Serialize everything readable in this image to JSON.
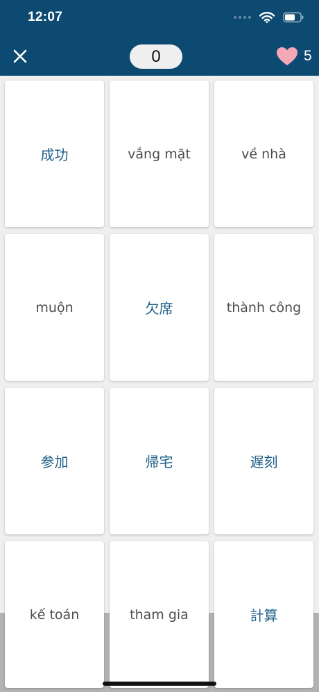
{
  "status_bar": {
    "time": "12:07"
  },
  "header": {
    "score": "0",
    "lives": "5",
    "colors": {
      "bar": "#0d4a72",
      "heart": "#f5a9b8"
    }
  },
  "cards": [
    {
      "text": "成功",
      "lang": "zh"
    },
    {
      "text": "vắng mặt",
      "lang": "vi"
    },
    {
      "text": "về nhà",
      "lang": "vi"
    },
    {
      "text": "muộn",
      "lang": "vi"
    },
    {
      "text": "欠席",
      "lang": "zh"
    },
    {
      "text": "thành công",
      "lang": "vi"
    },
    {
      "text": "参加",
      "lang": "zh"
    },
    {
      "text": "帰宅",
      "lang": "zh"
    },
    {
      "text": "遅刻",
      "lang": "zh"
    },
    {
      "text": "kế toán",
      "lang": "vi"
    },
    {
      "text": "tham gia",
      "lang": "vi"
    },
    {
      "text": "計算",
      "lang": "zh"
    }
  ]
}
